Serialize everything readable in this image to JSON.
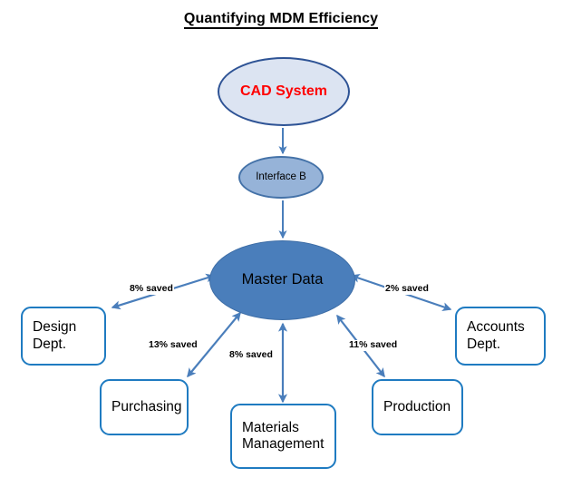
{
  "title": "Quantifying MDM Efficiency",
  "colors": {
    "cad_fill": "#dce4f2",
    "cad_border": "#2e5395",
    "cad_text": "#ff0000",
    "interface_fill": "#96b3d8",
    "interface_border": "#4472a8",
    "master_fill": "#4a7ebb",
    "master_border": "#3d6da6",
    "box_border": "#1f7bc1",
    "box_fill": "#ffffff",
    "arrow": "#4a7ebb",
    "text": "#000000"
  },
  "nodes": {
    "cad": {
      "label": "CAD System",
      "shape": "ellipse"
    },
    "interface": {
      "label": "Interface B",
      "shape": "ellipse"
    },
    "master": {
      "label": "Master Data",
      "shape": "ellipse"
    },
    "design": {
      "label": "Design\nDept.",
      "shape": "rounded-rect"
    },
    "accounts": {
      "label": "Accounts\nDept.",
      "shape": "rounded-rect"
    },
    "purchasing": {
      "label": "Purchasing",
      "shape": "rounded-rect"
    },
    "materials": {
      "label": "Materials\nManagement",
      "shape": "rounded-rect"
    },
    "production": {
      "label": "Production",
      "shape": "rounded-rect"
    }
  },
  "edges": [
    {
      "from": "cad",
      "to": "interface",
      "label": "",
      "arrow": "single"
    },
    {
      "from": "interface",
      "to": "master",
      "label": "",
      "arrow": "single"
    },
    {
      "from": "master",
      "to": "design",
      "label": "8% saved",
      "arrow": "double"
    },
    {
      "from": "master",
      "to": "accounts",
      "label": "2% saved",
      "arrow": "double"
    },
    {
      "from": "master",
      "to": "purchasing",
      "label": "13% saved",
      "arrow": "double"
    },
    {
      "from": "master",
      "to": "materials",
      "label": "8% saved",
      "arrow": "double"
    },
    {
      "from": "master",
      "to": "production",
      "label": "11% saved",
      "arrow": "double"
    }
  ],
  "edge_labels": {
    "design": "8% saved",
    "accounts": "2% saved",
    "purchasing": "13% saved",
    "materials": "8% saved",
    "production": "11% saved"
  }
}
